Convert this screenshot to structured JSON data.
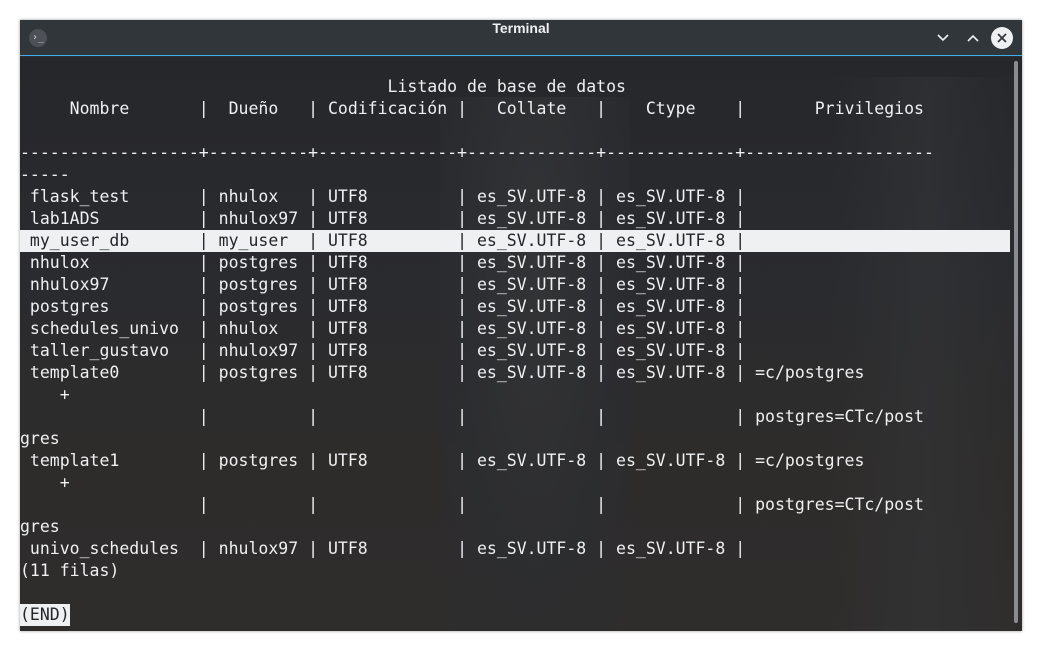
{
  "window": {
    "title": "Terminal",
    "icon": "terminal-icon",
    "app_icon_glyph": "›_",
    "controls": [
      "minimize-icon",
      "maximize-icon",
      "close-icon"
    ]
  },
  "terminal": {
    "lines": [
      "                                     Listado de base de datos",
      "     Nombre       |  Dueño   | Codificación |   Collate   |    Ctype    |       Privilegios",
      "",
      "------------------+----------+--------------+-------------+-------------+-------------------",
      "-----",
      " flask_test       | nhulox   | UTF8         | es_SV.UTF-8 | es_SV.UTF-8 |",
      " lab1ADS          | nhulox97 | UTF8         | es_SV.UTF-8 | es_SV.UTF-8 |",
      " my_user_db       | my_user  | UTF8         | es_SV.UTF-8 | es_SV.UTF-8 |",
      " nhulox           | postgres | UTF8         | es_SV.UTF-8 | es_SV.UTF-8 |",
      " nhulox97         | postgres | UTF8         | es_SV.UTF-8 | es_SV.UTF-8 |",
      " postgres         | postgres | UTF8         | es_SV.UTF-8 | es_SV.UTF-8 |",
      " schedules_univo  | nhulox   | UTF8         | es_SV.UTF-8 | es_SV.UTF-8 |",
      " taller_gustavo   | nhulox97 | UTF8         | es_SV.UTF-8 | es_SV.UTF-8 |",
      " template0        | postgres | UTF8         | es_SV.UTF-8 | es_SV.UTF-8 | =c/postgres",
      "    +",
      "                  |          |              |             |             | postgres=CTc/post",
      "gres",
      " template1        | postgres | UTF8         | es_SV.UTF-8 | es_SV.UTF-8 | =c/postgres",
      "    +",
      "                  |          |              |             |             | postgres=CTc/post",
      "gres",
      " univo_schedules  | nhulox97 | UTF8         | es_SV.UTF-8 | es_SV.UTF-8 |",
      "(11 filas)",
      ""
    ],
    "highlighted_line_index": 7,
    "end_marker": "(END)"
  }
}
